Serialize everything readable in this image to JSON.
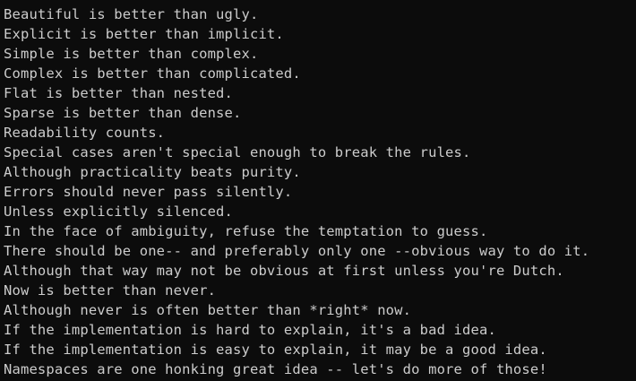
{
  "console": {
    "lines": [
      "Beautiful is better than ugly.",
      "Explicit is better than implicit.",
      "Simple is better than complex.",
      "Complex is better than complicated.",
      "Flat is better than nested.",
      "Sparse is better than dense.",
      "Readability counts.",
      "Special cases aren't special enough to break the rules.",
      "Although practicality beats purity.",
      "Errors should never pass silently.",
      "Unless explicitly silenced.",
      "In the face of ambiguity, refuse the temptation to guess.",
      "There should be one-- and preferably only one --obvious way to do it.",
      "Although that way may not be obvious at first unless you're Dutch.",
      "Now is better than never.",
      "Although never is often better than *right* now.",
      "If the implementation is hard to explain, it's a bad idea.",
      "If the implementation is easy to explain, it may be a good idea.",
      "Namespaces are one honking great idea -- let's do more of those!"
    ]
  },
  "colors": {
    "background": "#0c0c0c",
    "text": "#cccccc"
  }
}
